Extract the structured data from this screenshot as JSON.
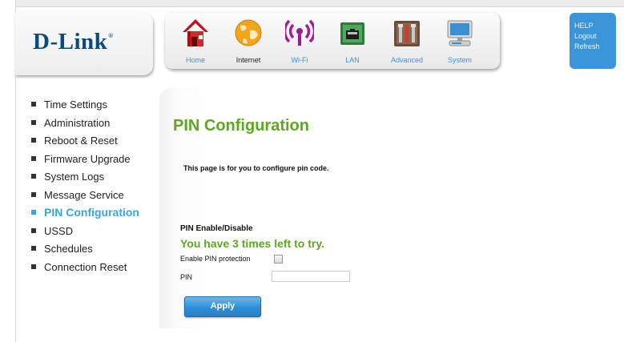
{
  "brand": {
    "logo_text": "D-Link",
    "logo_mark": "®"
  },
  "nav": {
    "home": {
      "label": "Home",
      "icon": "home-icon",
      "color": "#3a96d8"
    },
    "internet": {
      "label": "Internet",
      "icon": "globe-icon",
      "color": "#222222"
    },
    "wifi": {
      "label": "Wi-Fi",
      "icon": "wifi-icon",
      "color": "#3a96d8"
    },
    "lan": {
      "label": "LAN",
      "icon": "lan-port-icon",
      "color": "#3a96d8"
    },
    "advanced": {
      "label": "Advanced",
      "icon": "tools-icon",
      "color": "#3a96d8"
    },
    "system": {
      "label": "System",
      "icon": "computer-icon",
      "color": "#3a96d8"
    }
  },
  "help_panel": {
    "help": "HELP",
    "logout": "Logout",
    "refresh": "Refresh"
  },
  "sidebar": {
    "items": [
      {
        "label": "Time Settings"
      },
      {
        "label": "Administration"
      },
      {
        "label": "Reboot & Reset"
      },
      {
        "label": "Firmware Upgrade"
      },
      {
        "label": "System Logs"
      },
      {
        "label": "Message Service"
      },
      {
        "label": "PIN Configuration",
        "active": true
      },
      {
        "label": "USSD"
      },
      {
        "label": "Schedules"
      },
      {
        "label": "Connection Reset"
      }
    ]
  },
  "main": {
    "title": "PIN Configuration",
    "intro": "This page is for you to configure pin code.",
    "section_title": "PIN Enable/Disable",
    "tries_message": "You have 3 times left to try.",
    "enable_label": "Enable PIN protection",
    "enable_checked": false,
    "pin_label": "PIN",
    "pin_value": "",
    "apply_label": "Apply"
  },
  "colors": {
    "accent_green": "#5da81f",
    "accent_blue": "#35a6e0",
    "brand_blue": "#0b4a7c"
  }
}
